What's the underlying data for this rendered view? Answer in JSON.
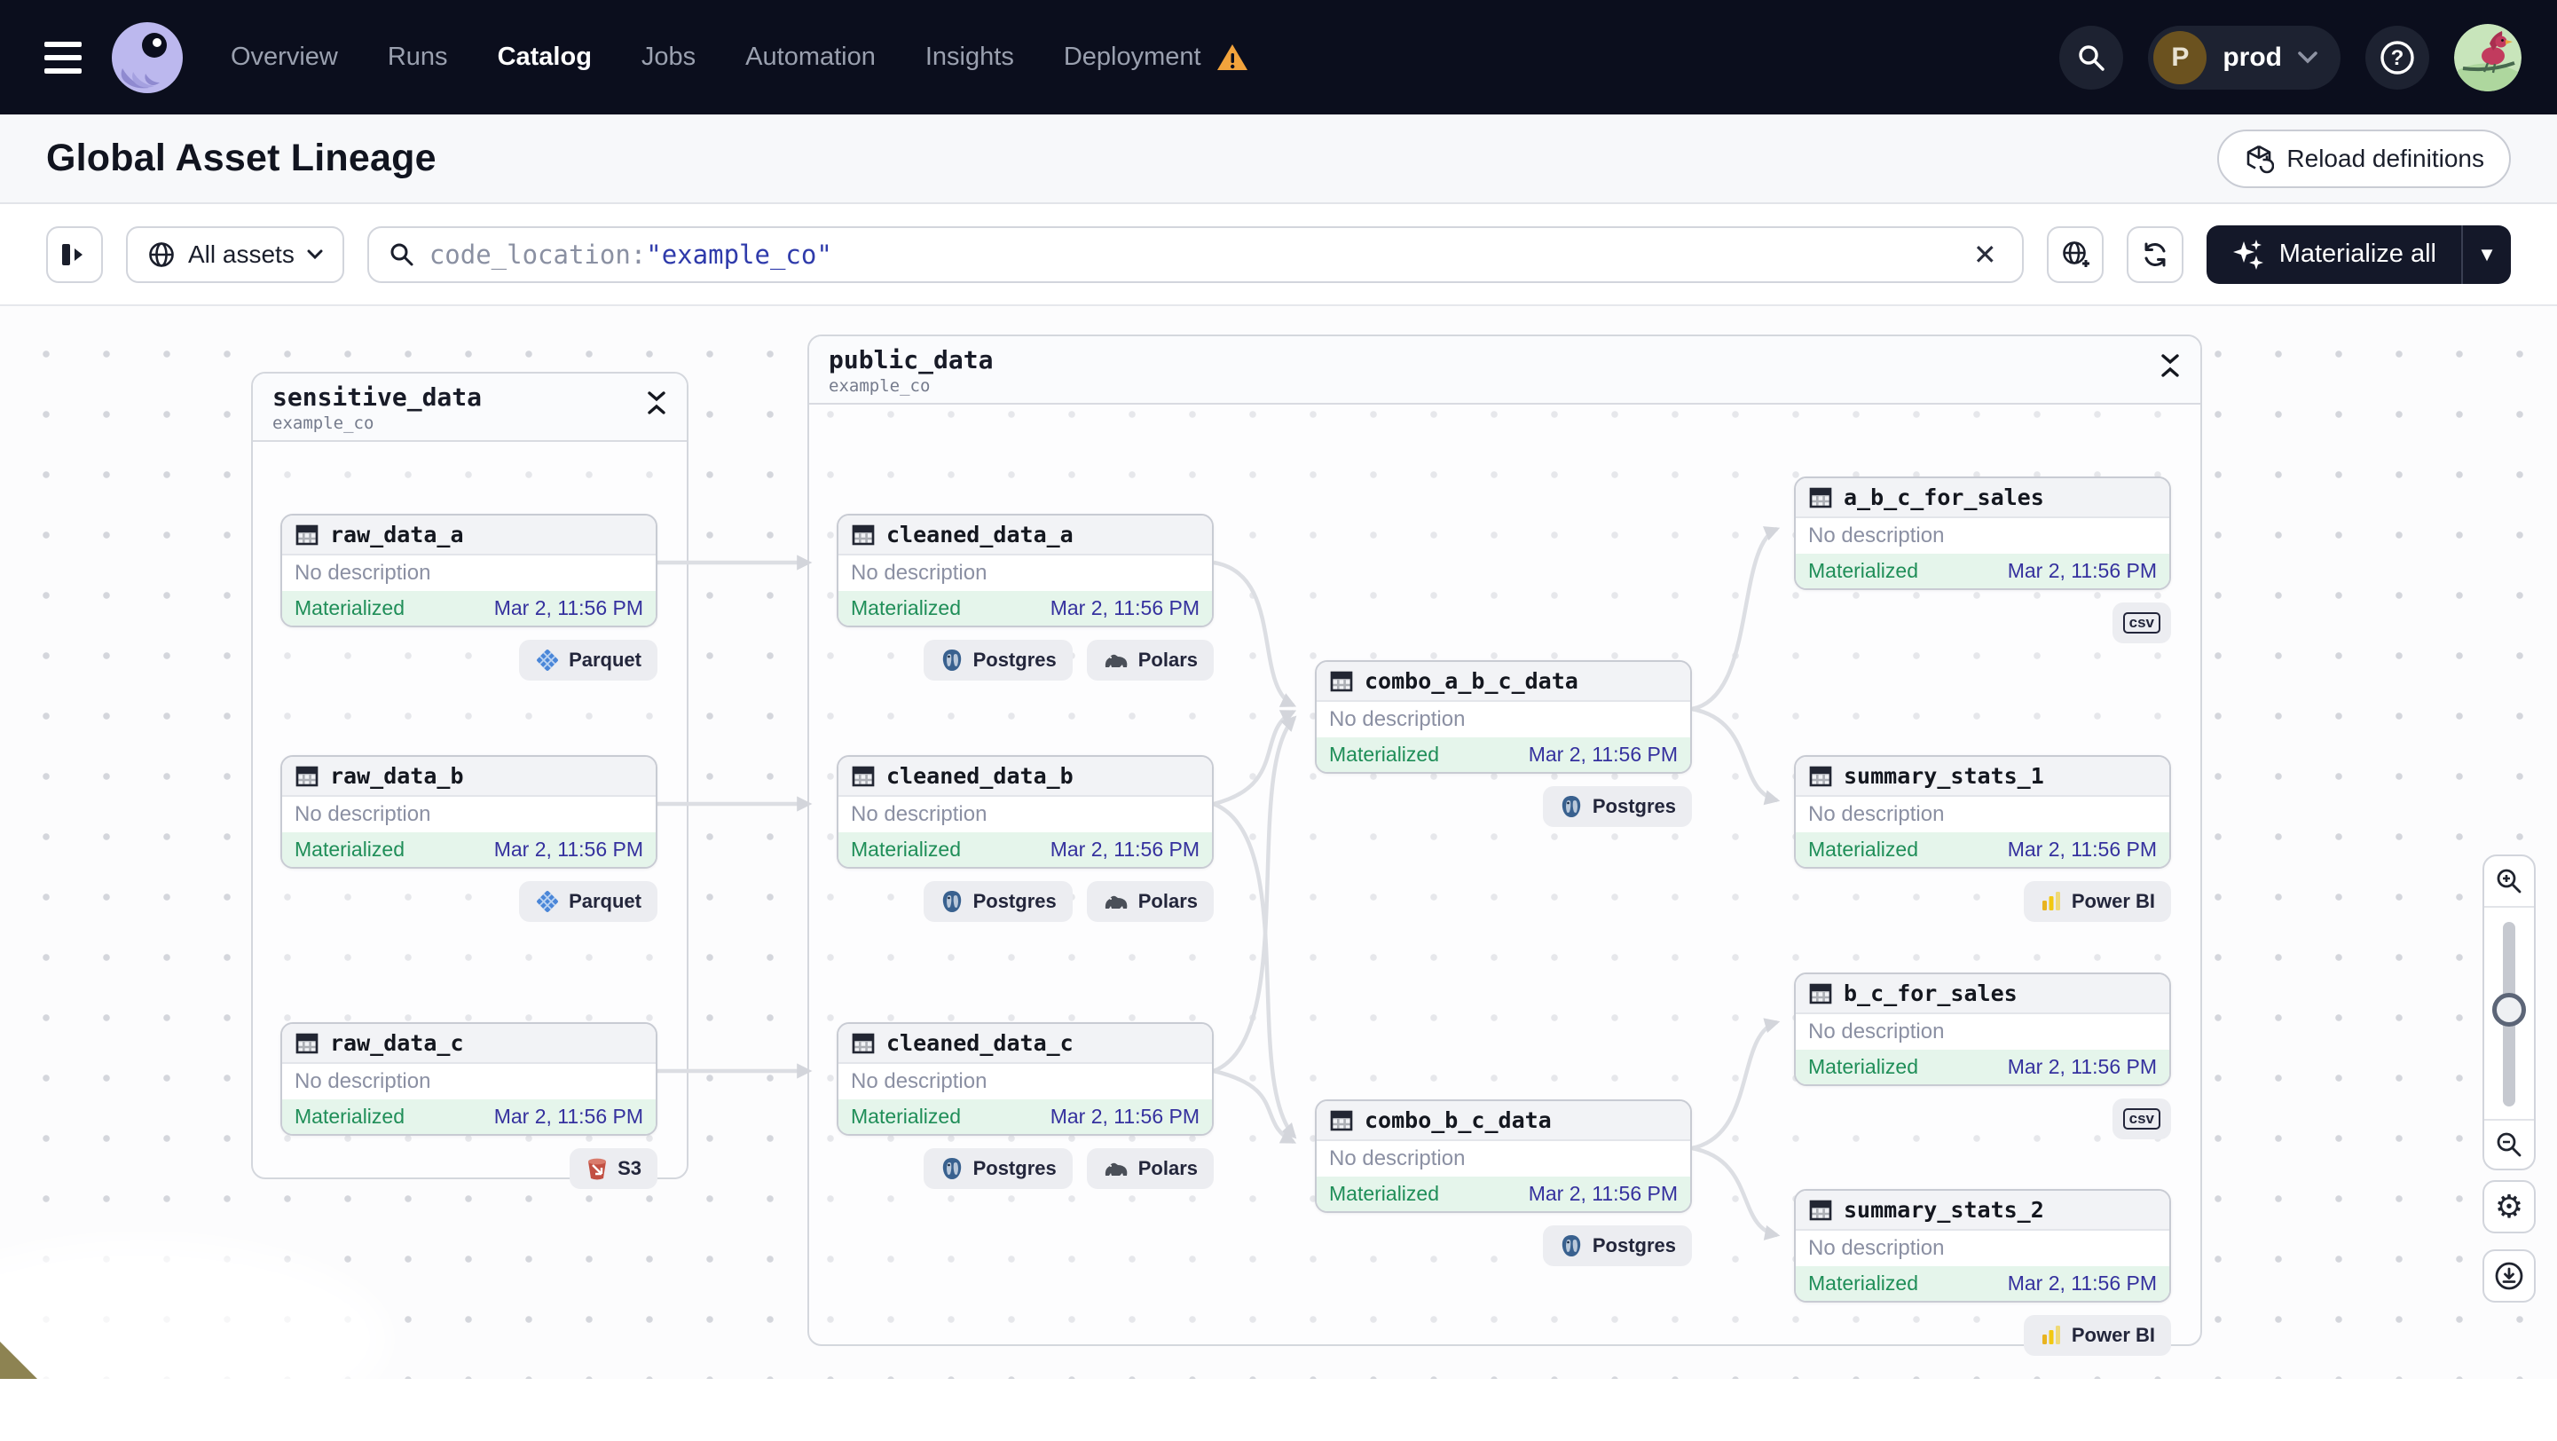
{
  "nav": {
    "items": [
      {
        "label": "Overview"
      },
      {
        "label": "Runs"
      },
      {
        "label": "Catalog"
      },
      {
        "label": "Jobs"
      },
      {
        "label": "Automation"
      },
      {
        "label": "Insights"
      },
      {
        "label": "Deployment"
      }
    ],
    "active_item": "Catalog",
    "env": {
      "initial": "P",
      "label": "prod"
    }
  },
  "header": {
    "title": "Global Asset Lineage",
    "reload_label": "Reload definitions"
  },
  "toolbar": {
    "scope_label": "All assets",
    "search_field": "code_location:",
    "search_value": "\"example_co\"",
    "materialize_label": "Materialize all"
  },
  "graph": {
    "groups": {
      "sensitive_data": {
        "name": "sensitive_data",
        "location": "example_co"
      },
      "public_data": {
        "name": "public_data",
        "location": "example_co"
      }
    },
    "nodes": {
      "raw_data_a": {
        "label": "raw_data_a",
        "description": "No description",
        "status": "Materialized",
        "timestamp": "Mar 2, 11:56 PM",
        "tags": [
          "Parquet"
        ]
      },
      "raw_data_b": {
        "label": "raw_data_b",
        "description": "No description",
        "status": "Materialized",
        "timestamp": "Mar 2, 11:56 PM",
        "tags": [
          "Parquet"
        ]
      },
      "raw_data_c": {
        "label": "raw_data_c",
        "description": "No description",
        "status": "Materialized",
        "timestamp": "Mar 2, 11:56 PM",
        "tags": [
          "S3"
        ]
      },
      "cleaned_data_a": {
        "label": "cleaned_data_a",
        "description": "No description",
        "status": "Materialized",
        "timestamp": "Mar 2, 11:56 PM",
        "tags": [
          "Postgres",
          "Polars"
        ]
      },
      "cleaned_data_b": {
        "label": "cleaned_data_b",
        "description": "No description",
        "status": "Materialized",
        "timestamp": "Mar 2, 11:56 PM",
        "tags": [
          "Postgres",
          "Polars"
        ]
      },
      "cleaned_data_c": {
        "label": "cleaned_data_c",
        "description": "No description",
        "status": "Materialized",
        "timestamp": "Mar 2, 11:56 PM",
        "tags": [
          "Postgres",
          "Polars"
        ]
      },
      "combo_a_b_c_data": {
        "label": "combo_a_b_c_data",
        "description": "No description",
        "status": "Materialized",
        "timestamp": "Mar 2, 11:56 PM",
        "tags": [
          "Postgres"
        ]
      },
      "combo_b_c_data": {
        "label": "combo_b_c_data",
        "description": "No description",
        "status": "Materialized",
        "timestamp": "Mar 2, 11:56 PM",
        "tags": [
          "Postgres"
        ]
      },
      "a_b_c_for_sales": {
        "label": "a_b_c_for_sales",
        "description": "No description",
        "status": "Materialized",
        "timestamp": "Mar 2, 11:56 PM",
        "tags": [
          "csv"
        ]
      },
      "summary_stats_1": {
        "label": "summary_stats_1",
        "description": "No description",
        "status": "Materialized",
        "timestamp": "Mar 2, 11:56 PM",
        "tags": [
          "Power BI"
        ]
      },
      "b_c_for_sales": {
        "label": "b_c_for_sales",
        "description": "No description",
        "status": "Materialized",
        "timestamp": "Mar 2, 11:56 PM",
        "tags": [
          "csv"
        ]
      },
      "summary_stats_2": {
        "label": "summary_stats_2",
        "description": "No description",
        "status": "Materialized",
        "timestamp": "Mar 2, 11:56 PM",
        "tags": [
          "Power BI"
        ]
      }
    }
  },
  "colors": {
    "nav_bg": "#0b0e1d",
    "accent_dark": "#141829",
    "materialized_green": "#1f8e58",
    "materialized_bg": "#e5f5eb",
    "timestamp_indigo": "#35319e",
    "query_value_indigo": "#2f3bab",
    "warning_orange": "#f2a33c",
    "edge_gray": "#dcdee3"
  }
}
